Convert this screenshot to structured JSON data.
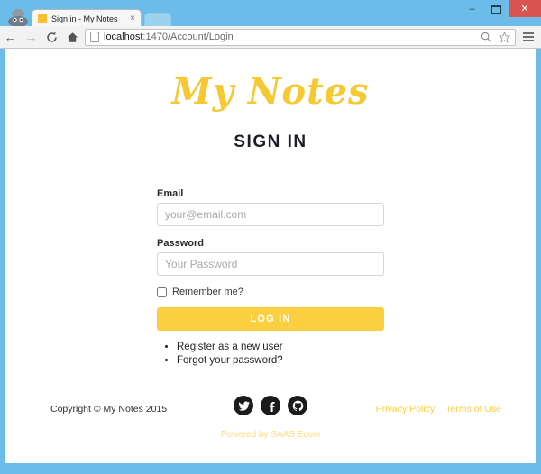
{
  "browser": {
    "tab": {
      "title": "Sign in - My Notes",
      "favicon_color": "#fbc02d",
      "close_label": "×"
    },
    "nav": {
      "back": "←",
      "forward": "→",
      "reload": "C",
      "home": "⌂"
    },
    "address": {
      "host": "localhost",
      "path": ":1470/Account/Login",
      "full": "localhost:1470/Account/Login"
    },
    "omni_icons": {
      "search": "search-icon",
      "bookmark": "star-icon",
      "menu": "hamburger-menu-icon"
    },
    "window_controls": {
      "minimize": "–",
      "maximize": "❐",
      "close": "✕"
    },
    "frame_color": "#6cbcea"
  },
  "page": {
    "brand": "My Notes",
    "brand_color": "#f6c832",
    "heading": "SIGN IN",
    "form": {
      "email": {
        "label": "Email",
        "placeholder": "your@email.com",
        "value": ""
      },
      "password": {
        "label": "Password",
        "placeholder": "Your Password",
        "value": ""
      },
      "remember": {
        "label": "Remember me?",
        "checked": false
      },
      "submit": {
        "label": "LOG IN",
        "color": "#fbcf3f"
      }
    },
    "links": [
      {
        "label": "Register as a new user"
      },
      {
        "label": "Forgot your password?"
      }
    ],
    "footer": {
      "copyright": "Copyright © My Notes 2015",
      "socials": [
        {
          "name": "twitter-icon"
        },
        {
          "name": "facebook-icon"
        },
        {
          "name": "github-icon"
        }
      ],
      "legal": [
        {
          "label": "Privacy Policy"
        },
        {
          "label": "Terms of Use"
        }
      ],
      "powered": "Powered by SAAS Ecom",
      "accent_color": "#fbcf3f"
    }
  }
}
